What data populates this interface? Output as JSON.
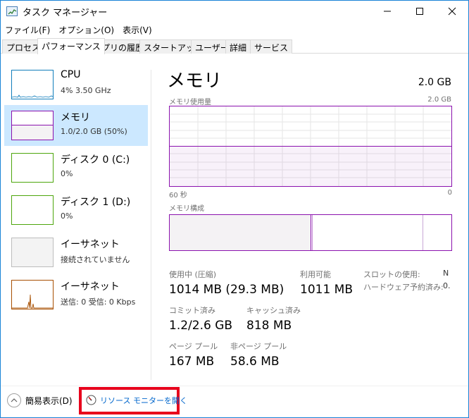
{
  "window": {
    "title": "タスク マネージャー"
  },
  "menu": [
    "ファイル(F)",
    "オプション(O)",
    "表示(V)"
  ],
  "tabs": [
    "プロセス",
    "パフォーマンス",
    "アプリの履歴",
    "スタートアップ",
    "ユーザー",
    "詳細",
    "サービス"
  ],
  "active_tab": "パフォーマンス",
  "sidebar": {
    "items": [
      {
        "title": "CPU",
        "sub": "4%  3.50 GHz",
        "color": "#117dbb"
      },
      {
        "title": "メモリ",
        "sub": "1.0/2.0 GB (50%)",
        "color": "#8b12ae",
        "selected": true
      },
      {
        "title": "ディスク 0 (C:)",
        "sub": "0%",
        "color": "#4da60c"
      },
      {
        "title": "ディスク 1 (D:)",
        "sub": "0%",
        "color": "#4da60c"
      },
      {
        "title": "イーサネット",
        "sub": "接続されていません",
        "color": "#bcbcbc"
      },
      {
        "title": "イーサネット",
        "sub": "送信: 0 受信: 0 Kbps",
        "color": "#a74f01"
      }
    ]
  },
  "memory": {
    "title": "メモリ",
    "total": "2.0 GB",
    "usage_label": "メモリ使用量",
    "usage_max": "2.0 GB",
    "usage_fraction": 0.5,
    "axis_left": "60 秒",
    "axis_right": "0",
    "composition_label": "メモリ構成",
    "stats": {
      "in_use_label": "使用中 (圧縮)",
      "in_use_value": "1014 MB (29.3 MB)",
      "available_label": "利用可能",
      "available_value": "1011 MB",
      "slots_label": "スロットの使用:",
      "slots_value": "N",
      "hw_reserved_label": "ハードウェア予約済み:",
      "hw_reserved_value": "0.",
      "committed_label": "コミット済み",
      "committed_value": "1.2/2.6 GB",
      "cached_label": "キャッシュ済み",
      "cached_value": "818 MB",
      "paged_label": "ページ プール",
      "paged_value": "167 MB",
      "nonpaged_label": "非ページ プール",
      "nonpaged_value": "58.6 MB"
    }
  },
  "footer": {
    "fewer_details": "簡易表示(D)",
    "resource_monitor": "リソース モニターを開く"
  },
  "colors": {
    "memory": "#8b12ae",
    "selection": "#cce8ff",
    "highlight_box": "#e8001c",
    "link": "#0066cc"
  }
}
